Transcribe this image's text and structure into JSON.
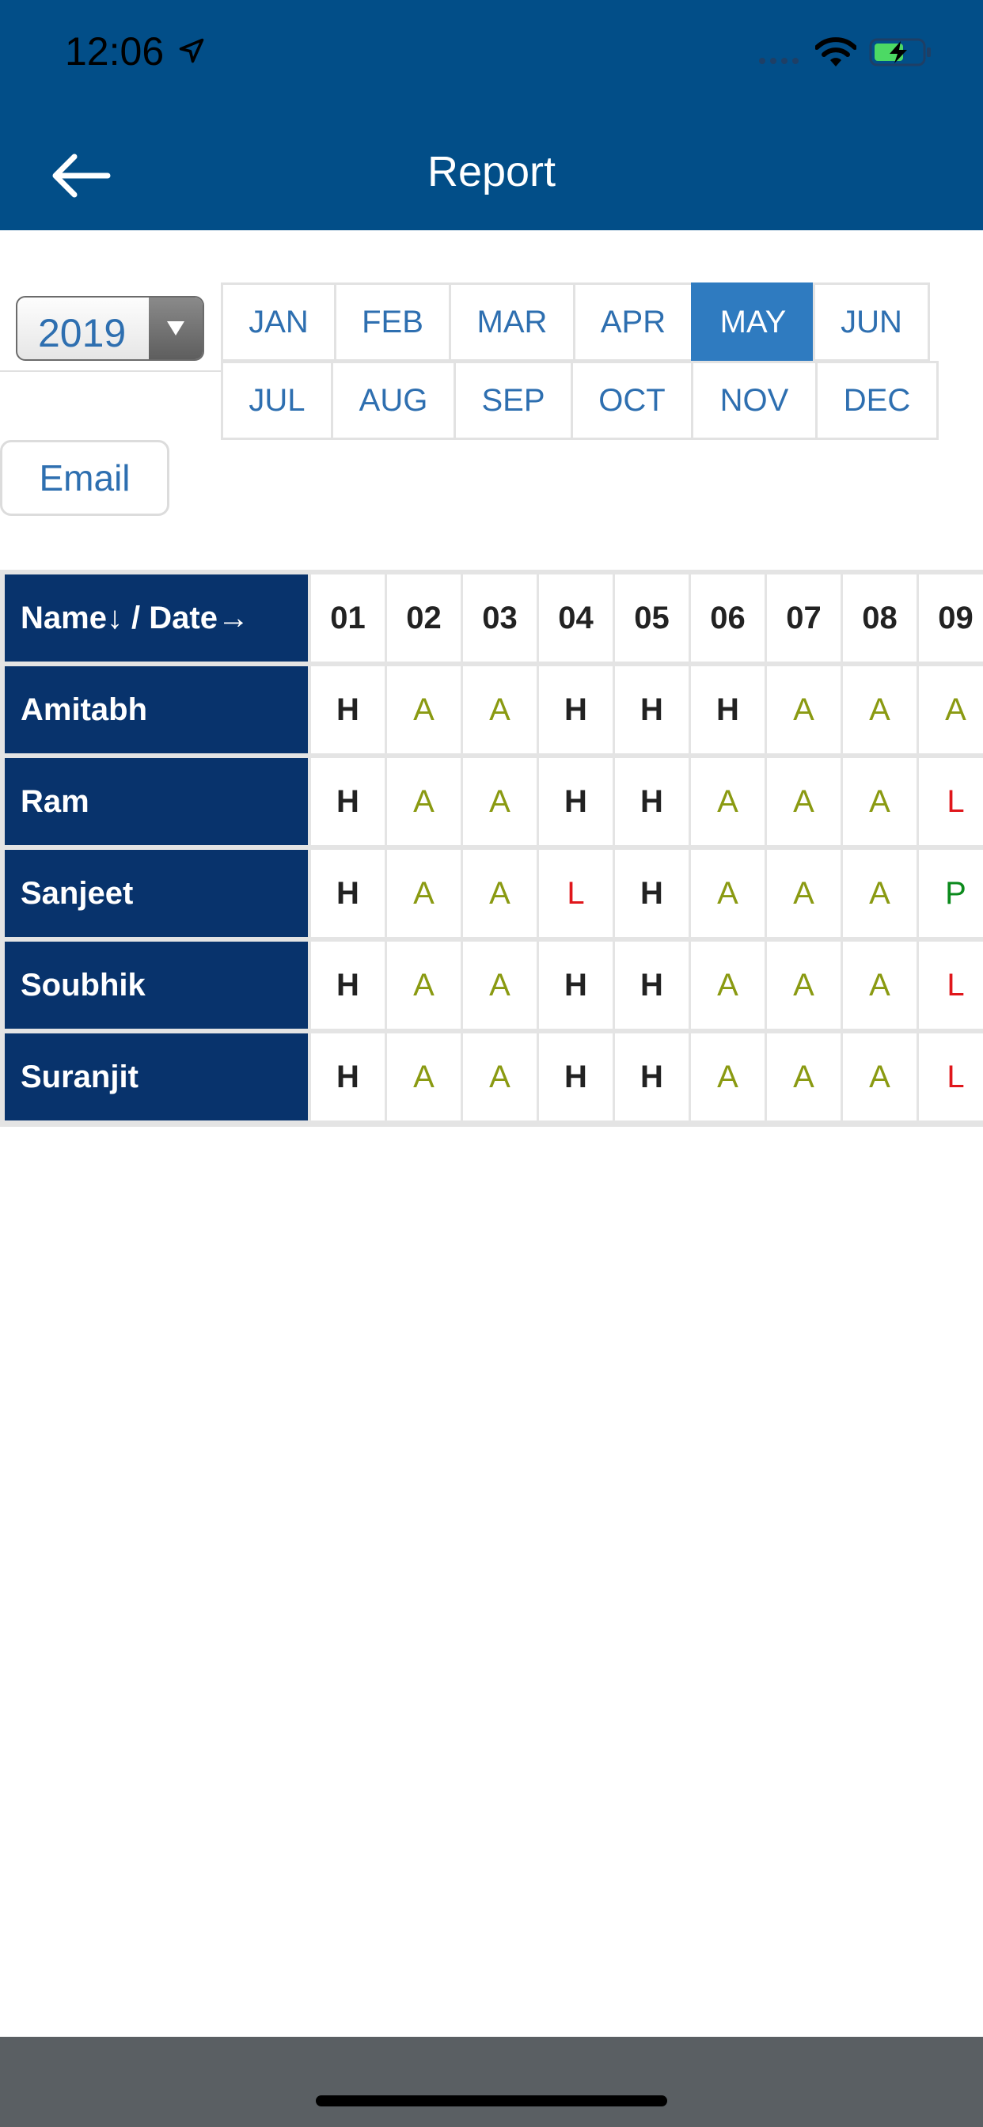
{
  "status_bar": {
    "time": "12:06"
  },
  "header": {
    "title": "Report"
  },
  "year_select": {
    "value": "2019"
  },
  "months": {
    "row1": [
      "JAN",
      "FEB",
      "MAR",
      "APR",
      "MAY",
      "JUN"
    ],
    "row2": [
      "JUL",
      "AUG",
      "SEP",
      "OCT",
      "NOV",
      "DEC"
    ],
    "selected": "MAY"
  },
  "email_button": {
    "label": "Email"
  },
  "table": {
    "corner_label": "Name↓ / Date→",
    "dates": [
      "01",
      "02",
      "03",
      "04",
      "05",
      "06",
      "07",
      "08",
      "09"
    ],
    "rows": [
      {
        "name": "Amitabh",
        "values": [
          "H",
          "A",
          "A",
          "H",
          "H",
          "H",
          "A",
          "A",
          "A"
        ]
      },
      {
        "name": "Ram",
        "values": [
          "H",
          "A",
          "A",
          "H",
          "H",
          "A",
          "A",
          "A",
          "L"
        ]
      },
      {
        "name": "Sanjeet",
        "values": [
          "H",
          "A",
          "A",
          "L",
          "H",
          "A",
          "A",
          "A",
          "P"
        ]
      },
      {
        "name": "Soubhik",
        "values": [
          "H",
          "A",
          "A",
          "H",
          "H",
          "A",
          "A",
          "A",
          "L"
        ]
      },
      {
        "name": "Suranjit",
        "values": [
          "H",
          "A",
          "A",
          "H",
          "H",
          "A",
          "A",
          "A",
          "L"
        ]
      }
    ]
  },
  "colors": {
    "header_bg": "#024e88",
    "accent": "#2f7bc0",
    "name_cell_bg": "#08336c",
    "H": "#222222",
    "A": "#8a9a12",
    "L": "#e0161b",
    "P": "#0b8a1c"
  }
}
